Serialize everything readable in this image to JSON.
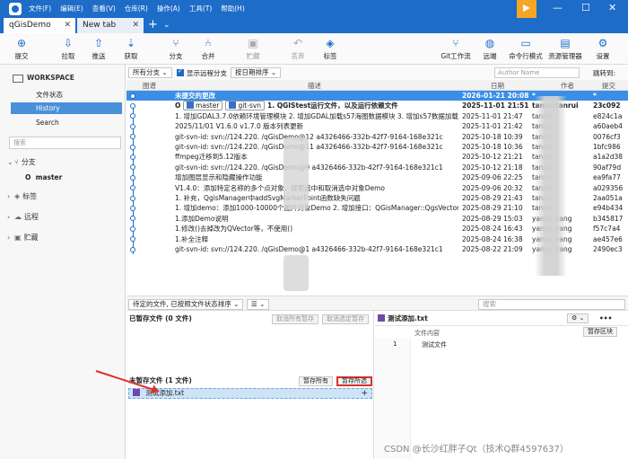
{
  "titlebar": {
    "menu": [
      "文件(F)",
      "编辑(E)",
      "查看(V)",
      "仓库(R)",
      "操作(A)",
      "工具(T)",
      "帮助(H)"
    ],
    "controls": {
      "minimize": "—",
      "maximize": "☐",
      "close": "✕"
    }
  },
  "tabs": [
    {
      "label": "qGisDemo",
      "close": "✕"
    },
    {
      "label": "New tab",
      "close": "✕"
    }
  ],
  "tab_add": "+",
  "tab_more": "⌄",
  "toolbar": {
    "left": [
      {
        "label": "提交",
        "icon": "⊕"
      },
      {
        "label": "拉取",
        "icon": "⇩"
      },
      {
        "label": "推送",
        "icon": "⇧"
      },
      {
        "label": "获取",
        "icon": "⇣"
      },
      {
        "label": "分支",
        "icon": "⑂"
      },
      {
        "label": "合并",
        "icon": "⑃"
      },
      {
        "label": "贮藏",
        "icon": "▣"
      },
      {
        "label": "丢弃",
        "icon": "↶"
      },
      {
        "label": "标签",
        "icon": "◈"
      }
    ],
    "right": [
      {
        "label": "Git工作流",
        "icon": "⑂"
      },
      {
        "label": "远端",
        "icon": "◍"
      },
      {
        "label": "命令行模式",
        "icon": "▭"
      },
      {
        "label": "资源管理器",
        "icon": "▤"
      },
      {
        "label": "设置",
        "icon": "⚙"
      }
    ]
  },
  "sidebar": {
    "workspace": "WORKSPACE",
    "items": [
      "文件状态",
      "History",
      "Search"
    ],
    "search_placeholder": "搜索",
    "groups": {
      "branches": "分支",
      "tags": "标签",
      "remotes": "远程",
      "stashes": "贮藏"
    },
    "branch_current": "master",
    "branch_marker": "O"
  },
  "filter": {
    "branches": "所有分支 ⌄",
    "show_remote": "显示远程分支",
    "sort": "按日期排序 ⌄",
    "author_placeholder": "Author Name",
    "jump": "跳转到:"
  },
  "table": {
    "headers": {
      "graph": "图谱",
      "desc": "描述",
      "date": "日期",
      "author": "作者",
      "commit": "提交"
    },
    "rows": [
      {
        "desc": "未提交的更改",
        "date": "2026-01-21 20:08",
        "author": "*",
        "author2": "",
        "hash": "*",
        "selected": true
      },
      {
        "desc": "1. QGIStest运行文件，以及运行依赖文件",
        "date": "2025-11-01 21:51",
        "author": "tanrui",
        "author2": "tanrui",
        "hash": "23c092",
        "bold": true,
        "refs": [
          "master",
          "git-svn"
        ],
        "ref_marker": "O"
      },
      {
        "desc": "1. 增加GDAL3.7.0依赖环境管理模块 2. 增加GDAL加载s57海图数据模块 3. 增加s57数据加载",
        "date": "2025-11-01 21:47",
        "author": "tanrui",
        "author2": "",
        "hash": "e824c1a"
      },
      {
        "desc": "2025/11/01 V1.6.0 v1.7.0 版本列表更新",
        "date": "2025-11-01 21:42",
        "author": "tanrui",
        "author2": "",
        "hash": "a60aeb4"
      },
      {
        "desc": "git-svn-id: svn://124.220.     /qGisDemo@12 a4326466-332b-42f7-9164-168e321c",
        "date": "2025-10-18 10:39",
        "author": "tanrui",
        "author2": "",
        "hash": "0076cf3"
      },
      {
        "desc": "git-svn-id: svn://124.220.     /qGisDemo@11 a4326466-332b-42f7-9164-168e321c",
        "date": "2025-10-18 10:36",
        "author": "tanrui",
        "author2": "",
        "hash": "1bfc986"
      },
      {
        "desc": "ffmpeg迁移到5.12版本",
        "date": "2025-10-12 21:21",
        "author": "tanrui",
        "author2": "",
        "hash": "a1a2d38"
      },
      {
        "desc": "git-svn-id: svn://124.220.     /qGisDemo@9 a4326466-332b-42f7-9164-168e321c1",
        "date": "2025-10-12 21:18",
        "author": "tanrui",
        "author2": "",
        "hash": "90af79d"
      },
      {
        "desc": "增加图层显示和隐藏操作功能",
        "date": "2025-09-06 22:25",
        "author": "tanrui",
        "author2": "",
        "hash": "ea9fa77"
      },
      {
        "desc": "V1.4.0：添加特定名称的多个点对象，搜索选中和取消选中对象Demo",
        "date": "2025-09-06 20:32",
        "author": "tanrui",
        "author2": "",
        "hash": "a029356"
      },
      {
        "desc": "1. 补充，QgisManager中addSvgMarkerPoint函数缺失问题",
        "date": "2025-08-29 21:43",
        "author": "tanrui",
        "author2": "",
        "hash": "2aa051a"
      },
      {
        "desc": "1. 增加demo：添加1000-10000个图片对象Demo 2. 增加接口：QGisManager::QgsVector",
        "date": "2025-08-29 21:10",
        "author": "tanrui",
        "author2": "",
        "hash": "e94b434"
      },
      {
        "desc": "1.添加Demo说明",
        "date": "2025-08-29 15:03",
        "author": "yangji",
        "author2": "yang",
        "hash": "b345817"
      },
      {
        "desc": "1.修改()去掉改为QVector等，不使用()",
        "date": "2025-08-24 16:43",
        "author": "yangji",
        "author2": "yang",
        "hash": "f57c7a4"
      },
      {
        "desc": "1.补全注释",
        "date": "2025-08-24 16:38",
        "author": "yangji",
        "author2": "yang",
        "hash": "ae457e6"
      },
      {
        "desc": "git-svn-id: svn://124.220.     /qGisDemo@1 a4326466-332b-42f7-9164-168e321c1",
        "date": "2025-08-22 21:09",
        "author": "yangji",
        "author2": "yang",
        "hash": "2490ec3"
      }
    ]
  },
  "lower_bar": {
    "sort": "待定的文件, 已按照文件状态排序 ⌄",
    "list_btn": "☰ ⌄",
    "search_placeholder": "搜索"
  },
  "staged": {
    "title": "已暂存文件 (0 文件)",
    "unstage_all": "取消所有暂存",
    "unstage_selected": "取消选定暂存"
  },
  "unstaged": {
    "title": "未暂存文件 (1 文件)",
    "stage_all": "暂存所有",
    "stage_selected": "暂存所选",
    "file": "测试添加.txt",
    "plus": "+"
  },
  "preview": {
    "file": "测试添加.txt",
    "content_label": "文件内容",
    "stage_chunk": "暂存区块",
    "line_no": "1",
    "line_text": "测试文件",
    "gear": "⚙ ⌄",
    "more": "•••"
  },
  "watermark": "CSDN @长沙红胖子Qt（技术Q群4597637）"
}
